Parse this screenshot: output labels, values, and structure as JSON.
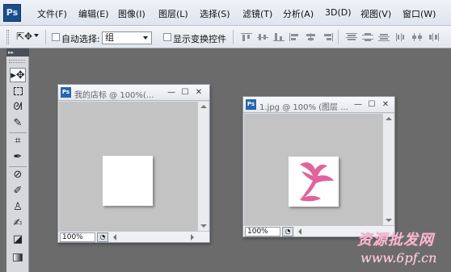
{
  "app": {
    "logo": "Ps"
  },
  "menu": {
    "items": [
      "文件(F)",
      "编辑(E)",
      "图像(I)",
      "图层(L)",
      "选择(S)",
      "滤镜(T)",
      "分析(A)",
      "3D(D)",
      "视图(V)",
      "窗口(W)"
    ]
  },
  "options": {
    "tool_preset_icon": "move-tool-icon",
    "auto_select_label": "自动选择:",
    "auto_select_value": "组",
    "show_transform_label": "显示变换控件"
  },
  "toolbox": {
    "header": "▸▸",
    "tools": [
      "move-tool",
      "marquee-tool",
      "lasso-tool",
      "quick-select-tool",
      "crop-tool",
      "eyedropper-tool",
      "healing-brush-tool",
      "brush-tool",
      "clone-stamp-tool",
      "history-brush-tool",
      "eraser-tool",
      "gradient-tool"
    ]
  },
  "documents": [
    {
      "title": "我的店标 @ 100%(...",
      "zoom": "100%"
    },
    {
      "title": "1.jpg @ 100% (图层 ...",
      "zoom": "100%"
    }
  ],
  "watermark": {
    "line1": "资源批发网",
    "line2": "www.6pf.cn"
  },
  "colors": {
    "logo_pink": "#e0649b",
    "accent_ps_blue": "#1a4f8f"
  }
}
